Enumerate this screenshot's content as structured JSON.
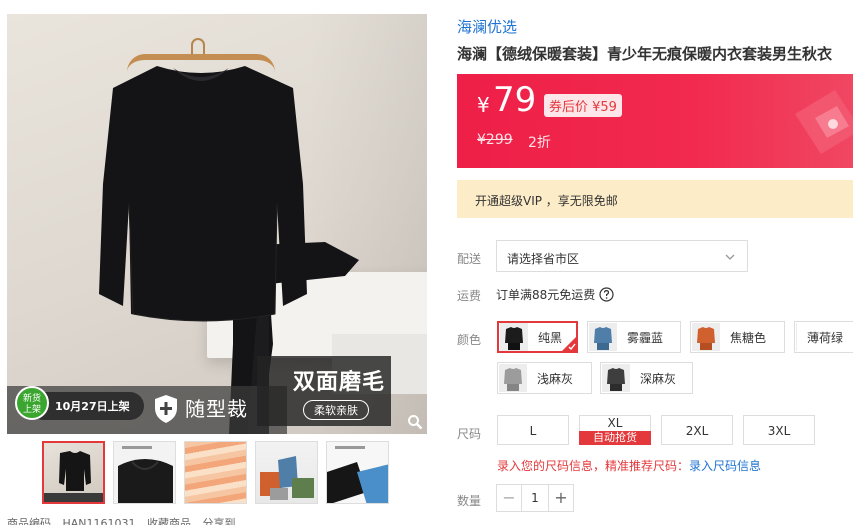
{
  "gallery": {
    "main_image_alt": "black long-sleeve thermal top and pants on hanger",
    "promo": {
      "new_badge_line1": "新货",
      "new_badge_line2": "上架",
      "date_text": "10月27日上架",
      "feature_label": "随型裁",
      "dual_title": "双面磨毛",
      "dual_sub": "柔软亲肤"
    },
    "thumbnails": [
      {
        "name": "thumb-black-set",
        "active": true
      },
      {
        "name": "thumb-collar-detail",
        "active": false
      },
      {
        "name": "thumb-fabric-layers",
        "active": false
      },
      {
        "name": "thumb-colors",
        "active": false
      },
      {
        "name": "thumb-cuff-detail",
        "active": false
      }
    ],
    "bottom_partial": {
      "item1": "商品编码",
      "item2": "HAN1161031",
      "item3": "收藏商品",
      "item4": "分享到"
    }
  },
  "product": {
    "shop_name": "海澜优选",
    "title": "海澜【德绒保暖套装】青少年无痕保暖内衣套装男生秋衣",
    "price": {
      "currency": "¥",
      "value": "79",
      "coupon_text": "券后价 ¥59",
      "original": "¥299",
      "discount": "2折"
    },
    "vip_text": "开通超级VIP ，享无限免邮"
  },
  "delivery": {
    "label": "配送",
    "select_placeholder": "请选择省市区"
  },
  "shipping": {
    "label": "运费",
    "info": "订单满88元免运费"
  },
  "colors": {
    "label": "颜色",
    "options": [
      {
        "name": "纯黑",
        "swatch": "#1c1c1c",
        "selected": true
      },
      {
        "name": "雾霾蓝",
        "swatch": "#4f7fa8",
        "selected": false
      },
      {
        "name": "焦糖色",
        "swatch": "#d0602d",
        "selected": false
      },
      {
        "name": "薄荷绿",
        "swatch": "#5e7e4e",
        "selected": false
      },
      {
        "name": "浅麻灰",
        "swatch": "#9c9c9c",
        "selected": false
      },
      {
        "name": "深麻灰",
        "swatch": "#3e3e3e",
        "selected": false
      }
    ]
  },
  "sizes": {
    "label": "尺码",
    "options": [
      {
        "name": "L",
        "badge": ""
      },
      {
        "name": "XL",
        "badge": "自动抢货"
      },
      {
        "name": "2XL",
        "badge": ""
      },
      {
        "name": "3XL",
        "badge": ""
      }
    ],
    "guide_text": "录入您的尺码信息，精准推荐尺码：",
    "guide_link": "录入尺码信息"
  },
  "quantity": {
    "label": "数量",
    "minus": "−",
    "value": "1",
    "plus": "+"
  },
  "theme": {
    "accent": "#e4393c",
    "link": "#1f73d1",
    "banner": "#ee1f48",
    "vip_bg": "#fdecc8"
  }
}
